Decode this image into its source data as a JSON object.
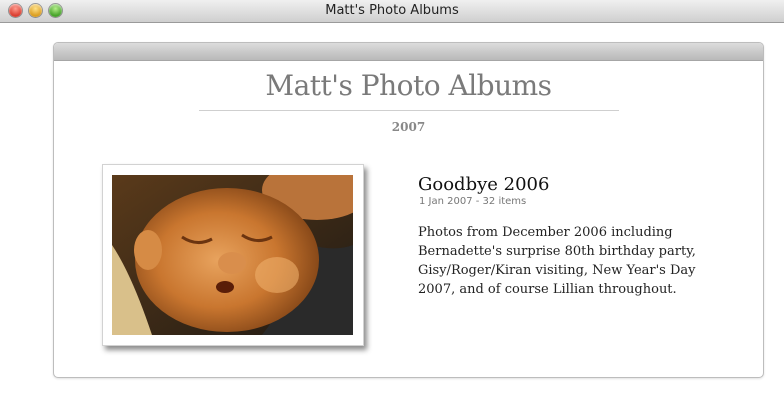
{
  "window": {
    "title": "Matt's Photo Albums"
  },
  "page": {
    "title": "Matt's Photo Albums",
    "year": "2007"
  },
  "albums": [
    {
      "title": "Goodbye 2006",
      "meta": "1 Jan 2007 - 32 items",
      "description": "Photos from December 2006 including Bernadette's surprise 80th birthday party, Gisy/Roger/Kiran visiting, New Year's Day 2007, and of course Lillian throughout."
    }
  ]
}
